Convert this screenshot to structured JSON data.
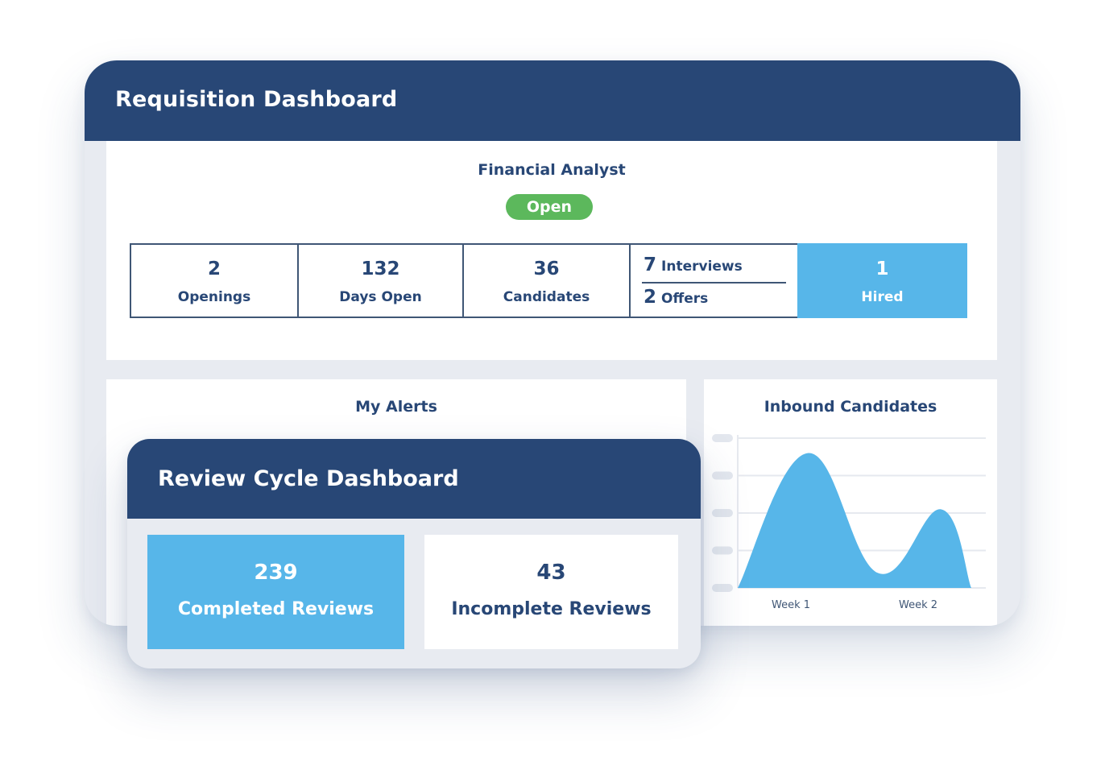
{
  "requisition": {
    "title": "Requisition Dashboard",
    "job_title": "Financial Analyst",
    "status": "Open",
    "stats": {
      "openings": {
        "value": "2",
        "label": "Openings"
      },
      "days_open": {
        "value": "132",
        "label": "Days Open"
      },
      "candidates": {
        "value": "36",
        "label": "Candidates"
      },
      "interviews": {
        "value": "7",
        "label": "Interviews"
      },
      "offers": {
        "value": "2",
        "label": "Offers"
      },
      "hired": {
        "value": "1",
        "label": "Hired"
      }
    },
    "alerts_title": "My Alerts",
    "inbound_title": "Inbound Candidates"
  },
  "review_cycle": {
    "title": "Review Cycle Dashboard",
    "completed": {
      "value": "239",
      "label": "Completed Reviews"
    },
    "incomplete": {
      "value": "43",
      "label": "Incomplete Reviews"
    }
  },
  "colors": {
    "navy": "#284776",
    "accent_blue": "#57b6e9",
    "status_green": "#5cb85c",
    "panel_bg": "#e8ebf1"
  },
  "chart_data": {
    "type": "area",
    "title": "Inbound Candidates",
    "categories": [
      "Week 1",
      "Week 2"
    ],
    "y_tick_labels_visible": false,
    "grid": true,
    "series": [
      {
        "values": [
          {
            "x": 0.0,
            "y": 0.0
          },
          {
            "x": 0.3,
            "y": 3.6
          },
          {
            "x": 0.6,
            "y": 0.4
          },
          {
            "x": 0.87,
            "y": 2.1
          },
          {
            "x": 1.0,
            "y": 0.0
          }
        ]
      }
    ],
    "ylim": [
      0,
      4
    ]
  }
}
